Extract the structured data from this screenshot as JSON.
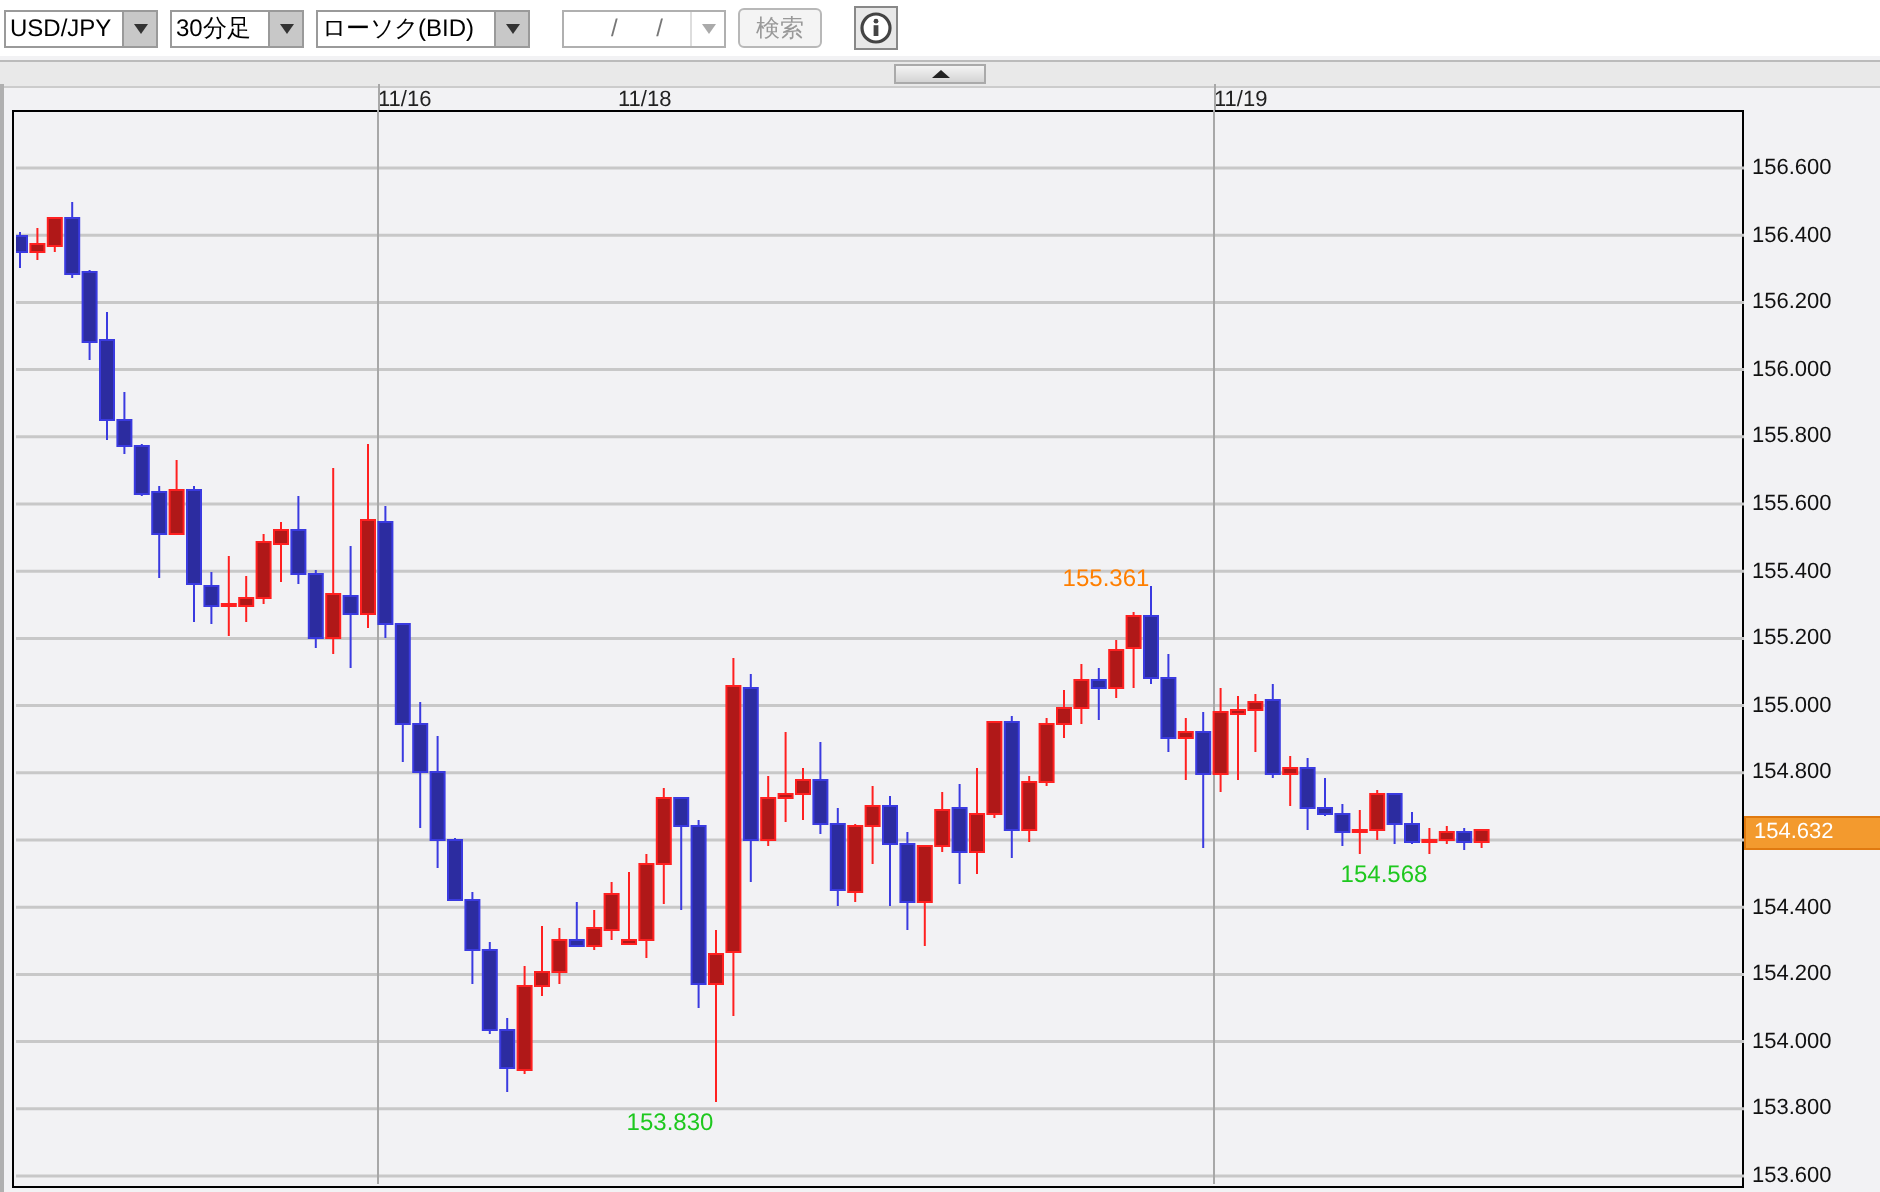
{
  "toolbar": {
    "pair": {
      "value": "USD/JPY"
    },
    "timeframe": {
      "value": "30分足"
    },
    "chart_type": {
      "value": "ローソク(BID)"
    },
    "date_field": {
      "placeholder": "/ /"
    },
    "search_button": {
      "label": "検索",
      "disabled": true
    }
  },
  "chart": {
    "date_labels": [
      {
        "label": "11/16",
        "gridline": true
      },
      {
        "label": "11/18",
        "gridline": false
      },
      {
        "label": "11/19",
        "gridline": true
      }
    ],
    "price_labels": [
      "156.600",
      "156.400",
      "156.200",
      "156.000",
      "155.800",
      "155.600",
      "155.400",
      "155.200",
      "155.000",
      "154.800",
      "154.400",
      "154.200",
      "154.000",
      "153.800",
      "153.600"
    ],
    "current_price": "154.632",
    "annotations": [
      {
        "kind": "high",
        "label": "155.361"
      },
      {
        "kind": "low",
        "label": "153.830"
      },
      {
        "kind": "low",
        "label": "154.568"
      }
    ]
  }
}
